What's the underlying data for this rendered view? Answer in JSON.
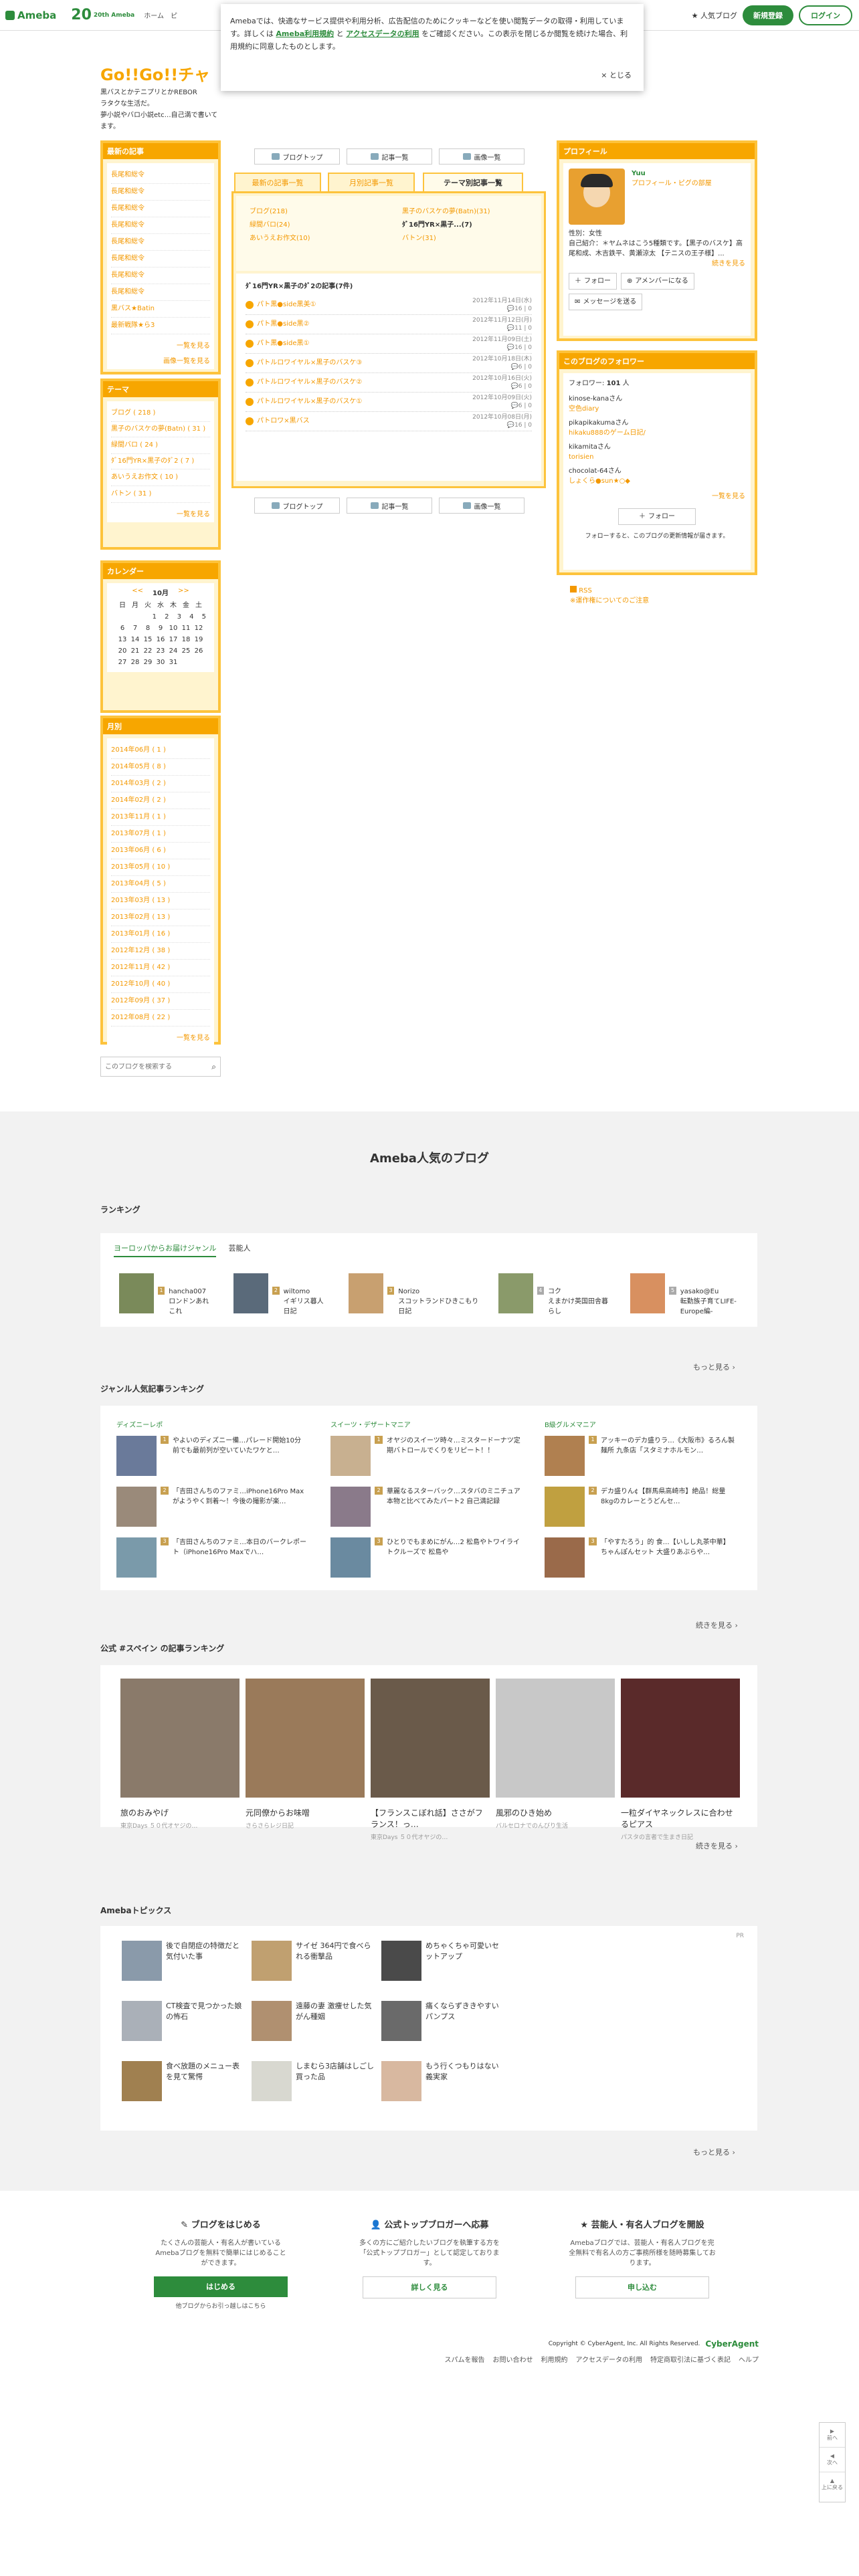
{
  "header": {
    "logo": "Ameba",
    "logo20_num": "20",
    "logo20_text": "20th Ameba",
    "nav": [
      "ホーム",
      "ピ"
    ],
    "popular": "人気ブログ",
    "register": "新規登録",
    "login": "ログイン"
  },
  "cookie": {
    "text1": "Amebaでは、快適なサービス提供や利用分析、広告配信のためにクッキーなどを使い閲覧データの取得・利用しています。詳しくは",
    "link1": "Ameba利用規約",
    "text2": "と",
    "link2": "アクセスデータの利用",
    "text3": "をご確認ください。この表示を閉じるか閲覧を続けた場合、利用規約に同意したものとします。",
    "close": "× とじる"
  },
  "blog": {
    "title": "Go!!Go!!チャ",
    "desc": [
      "黒バスとかテニプリとかREBOR",
      "ラタクな生活だ。",
      "夢小説やバロ小説etc…自己満で書いてます。"
    ]
  },
  "recent": {
    "title": "最新の記事",
    "items": [
      "長尾和総令",
      "長尾和総令",
      "長尾和総令",
      "長尾和総令",
      "長尾和総令",
      "長尾和総令",
      "長尾和総令",
      "長尾和総令",
      "黒バス★Batin",
      "最新戦隊★ら3"
    ],
    "more": "一覧を見る",
    "more2": "画像一覧を見る"
  },
  "theme": {
    "title": "テーマ",
    "items": [
      "ブログ ( 218 )",
      "黒子のバスケの夢(Batn) ( 31 )",
      "緑間バロ ( 24 )",
      "ﾀﾞ16門YR×黒子のﾀﾞ2 ( 7 )",
      "あいうえお作文 ( 10 )",
      "バトン ( 31 )"
    ],
    "more": "一覧を見る"
  },
  "calendar": {
    "title": "カレンダー",
    "prev": "<<",
    "month": "10月",
    "next": ">>",
    "days": [
      "日",
      "月",
      "火",
      "水",
      "木",
      "金",
      "土"
    ],
    "weeks": [
      [
        "",
        "",
        "",
        "1",
        "2",
        "3",
        "4",
        "5"
      ],
      [
        "6",
        "7",
        "8",
        "9",
        "10",
        "11",
        "12"
      ],
      [
        "13",
        "14",
        "15",
        "16",
        "17",
        "18",
        "19"
      ],
      [
        "20",
        "21",
        "22",
        "23",
        "24",
        "25",
        "26"
      ],
      [
        "27",
        "28",
        "29",
        "30",
        "31",
        "",
        ""
      ]
    ]
  },
  "monthly": {
    "title": "月別",
    "items": [
      "2014年06月 ( 1 )",
      "2014年05月 ( 8 )",
      "2014年03月 ( 2 )",
      "2014年02月 ( 2 )",
      "2013年11月 ( 1 )",
      "2013年07月 ( 1 )",
      "2013年06月 ( 6 )",
      "2013年05月 ( 10 )",
      "2013年04月 ( 5 )",
      "2013年03月 ( 13 )",
      "2013年02月 ( 13 )",
      "2013年01月 ( 16 )",
      "2012年12月 ( 38 )",
      "2012年11月 ( 42 )",
      "2012年10月 ( 40 )",
      "2012年09月 ( 37 )",
      "2012年08月 ( 22 )"
    ],
    "more": "一覧を見る"
  },
  "search": {
    "placeholder": "このブログを検索する"
  },
  "ctabs": {
    "top": "ブログトップ",
    "articles": "記事一覧",
    "images": "画像一覧"
  },
  "mtabs": {
    "latest": "最新の記事一覧",
    "monthly": "月別記事一覧",
    "theme": "テーマ別記事一覧"
  },
  "cats": {
    "left": [
      "ブログ(218)",
      "緑間バロ(24)",
      "あいうえお作文(10)"
    ],
    "right": [
      "黒子のバスケの夢(Batn)(31)",
      "ﾀﾞ16門YR×黒子...(7)",
      "バトン(31)"
    ]
  },
  "article_head": "ﾀﾞ16門YR×黒子のﾀﾞ2の記事(7件)",
  "articles": [
    {
      "t": "パト黒●side黒美①",
      "d": "2012年11月14日(水)",
      "c": "16 | 0"
    },
    {
      "t": "パト黒●side黒②",
      "d": "2012年11月12日(月)",
      "c": "11 | 0"
    },
    {
      "t": "パト黒●side黒①",
      "d": "2012年11月09日(土)",
      "c": "16 | 0"
    },
    {
      "t": "パトルロワイヤル×黒子のバスケ③",
      "d": "2012年10月18日(木)",
      "c": "6 | 0"
    },
    {
      "t": "パトルロワイヤル×黒子のバスケ②",
      "d": "2012年10月16日(火)",
      "c": "6 | 0"
    },
    {
      "t": "パトルロワイヤル×黒子のバスケ①",
      "d": "2012年10月09日(火)",
      "c": "6 | 0"
    },
    {
      "t": "パトロワ×黒バス",
      "d": "2012年10月08日(月)",
      "c": "16 | 0"
    }
  ],
  "profile": {
    "title": "プロフィール",
    "name": "Yuu",
    "link": "プロフィール・ピグの部屋",
    "gender": "性別：女性",
    "intro": "自己紹介：＊ヤムネはこう5種類です。【黒子のバスケ】高尾和成、木吉鉄平、黄瀬涼太 【テニスの王子様】...",
    "more": "続きを見る",
    "follow": "フォロー",
    "amember": "アメンバーになる",
    "message": "メッセージを送る"
  },
  "followers": {
    "title": "このブログのフォロワー",
    "count_label": "フォロワー:",
    "count": "101",
    "unit": "人",
    "list": [
      {
        "n": "kinose-kanaさん",
        "b": "空色diary"
      },
      {
        "n": "pikapikakumaさん",
        "b": "hikaku888のゲーム日記/"
      },
      {
        "n": "kikamitaさん",
        "b": "torisien"
      },
      {
        "n": "chocolat-64さん",
        "b": "しょくら●sun★○◆"
      }
    ],
    "more": "一覧を見る",
    "follow": "フォロー",
    "note": "フォローすると、このブログの更新情報が届きます。"
  },
  "rss": {
    "rss": "RSS",
    "guide": "※運作権についてのご注意"
  },
  "popular": {
    "title": "Ameba人気のブログ",
    "ranking": "ランキング",
    "tab1": "ヨーロッパからお届けジャンル",
    "tab2": "芸能人",
    "ranks": [
      {
        "n": "hancha007",
        "d": "ロンドンあれこれ"
      },
      {
        "n": "wiltomo",
        "d": "イギリス暮人日記"
      },
      {
        "n": "Norizo",
        "d": "スコットランドひきこもり日記"
      },
      {
        "n": "コク",
        "d": "えまかけ英国田舎暮らし"
      },
      {
        "n": "yasako@Eu",
        "d": "転勤族子育てLIFE-Europe編-"
      }
    ],
    "more": "もっと見る"
  },
  "genre": {
    "title": "ジャンル人気記事ランキング",
    "cols": [
      {
        "h": "ディズニーレポ",
        "items": [
          "やよいのディズニー備…パレード開始10分前でも最前列が空いていたワケと…",
          "「吉田さんちのファミ…iPhone16Pro Maxがようやく到着〜！今後の撮影が楽…",
          "「吉田さんちのファミ…本日のバークレポート（iPhone16Pro Maxでハ…"
        ]
      },
      {
        "h": "スイーツ・デザートマニア",
        "items": [
          "オヤジのスイーツ時々…ミスタードーナツ定期バトロールでくりをリピート！！",
          "華麗なるスターバック…スタバのミニチュア本物と比べてみたパート2 自己満記録",
          "ひとりでもまめにがん…2 松島やトワイライトクルーズで 松島や"
        ]
      },
      {
        "h": "B級グルメマニア",
        "items": [
          "アッキーのデカ盛りラ…《大阪市》るろん製麺所 九条店「スタミナホルモン…",
          "デカ盛りん¢【群馬県高崎市】絶品！総量8kgのカレーとうどんセ…",
          "「やすたろう」的 食…【いしし丸茶中華】ちゃんぽんセット 大盛りあぶらや…"
        ]
      }
    ],
    "more": "続きを見る"
  },
  "spain": {
    "title": "公式 #スペイン の記事ランキング",
    "items": [
      {
        "t": "旅のおみやげ",
        "a": "東京Days ５０代オヤジの…"
      },
      {
        "t": "元同僚からお味噌",
        "a": "さらさらレジ日記"
      },
      {
        "t": "【フランスこぼれ話】ささがフランス！っ…",
        "a": "東京Days ５０代オヤジの…"
      },
      {
        "t": "風邪のひき始め",
        "a": "バルセロナでのんびり生活"
      },
      {
        "t": "一粒ダイヤネックレスに合わせるピアス",
        "a": "パスタの言者で生まき日記"
      }
    ],
    "more": "続きを見る"
  },
  "topics": {
    "title": "Amebaトピックス",
    "pr": "PR",
    "items": [
      "後で自閉症の特徴だと気付いた事",
      "サイゼ 364円で食べられる衝撃品",
      "めちゃくちゃ可愛いセットアップ",
      "CT検査で見つかった娘の怖石",
      "遠藤の妻 激痩せした気がん種姻",
      "痛くならずききやすいパンプス",
      "食べ放題のメニュー表を見て驚愕",
      "しまむら3店舗はしごし買った品",
      "もう行くつもりはない義実家"
    ],
    "more": "もっと見る"
  },
  "footer": {
    "cols": [
      {
        "h": "ブログをはじめる",
        "p": "たくさんの芸能人・有名人が書いているAmebaブログを無料で簡単にはじめることができます。",
        "b": "はじめる",
        "s": "他ブログからお引っ越しはこちら"
      },
      {
        "h": "公式トップブロガーへ応募",
        "p": "多くの方にご紹介したいブログを執筆する方を「公式トップブロガー」として認定しております。",
        "b": "詳しく見る",
        "s": ""
      },
      {
        "h": "芸能人・有名人ブログを開設",
        "p": "Amebaブログでは、芸能人・有名人ブログを完全無料で有名人の方ご事務所様を随時募集しております。",
        "b": "申し込む",
        "s": ""
      }
    ],
    "copyright": "Copyright © CyberAgent, Inc. All Rights Reserved.",
    "ca": "CyberAgent",
    "links": [
      "スパムを報告",
      "お問い合わせ",
      "利用規約",
      "アクセスデータの利用",
      "特定商取引法に基づく表記",
      "ヘルプ"
    ]
  },
  "sidecontrols": {
    "prev": "前へ",
    "next": "次へ",
    "top": "上に戻る"
  },
  "colors": {
    "accent": "#f7a600",
    "brand": "#2d8c3c"
  }
}
